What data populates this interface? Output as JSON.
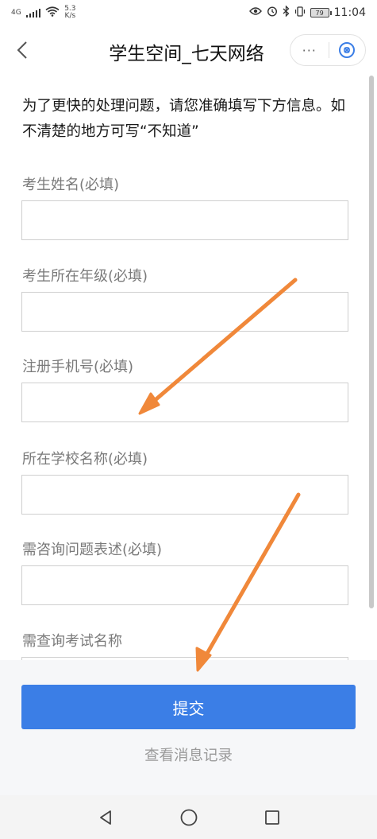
{
  "status_bar": {
    "network": "4G",
    "speed_value": "5.3",
    "speed_unit": "K/s",
    "battery": "79",
    "time": "11:04"
  },
  "header": {
    "title": "学生空间_七天网络",
    "back_icon": "chevron-left-icon",
    "more_label": "···"
  },
  "intro": "为了更快的处理问题，请您准确填写下方信息。如不清楚的地方可写“不知道”",
  "fields": [
    {
      "label": "考生姓名(必填)",
      "value": ""
    },
    {
      "label": "考生所在年级(必填)",
      "value": ""
    },
    {
      "label": "注册手机号(必填)",
      "value": ""
    },
    {
      "label": "所在学校名称(必填)",
      "value": ""
    },
    {
      "label": "需咨询问题表述(必填)",
      "value": ""
    },
    {
      "label": "需查询考试名称",
      "value": ""
    }
  ],
  "actions": {
    "submit_label": "提交",
    "history_label": "查看消息记录"
  },
  "colors": {
    "accent": "#3b7ee6",
    "annotation_arrow": "#f0883a"
  }
}
